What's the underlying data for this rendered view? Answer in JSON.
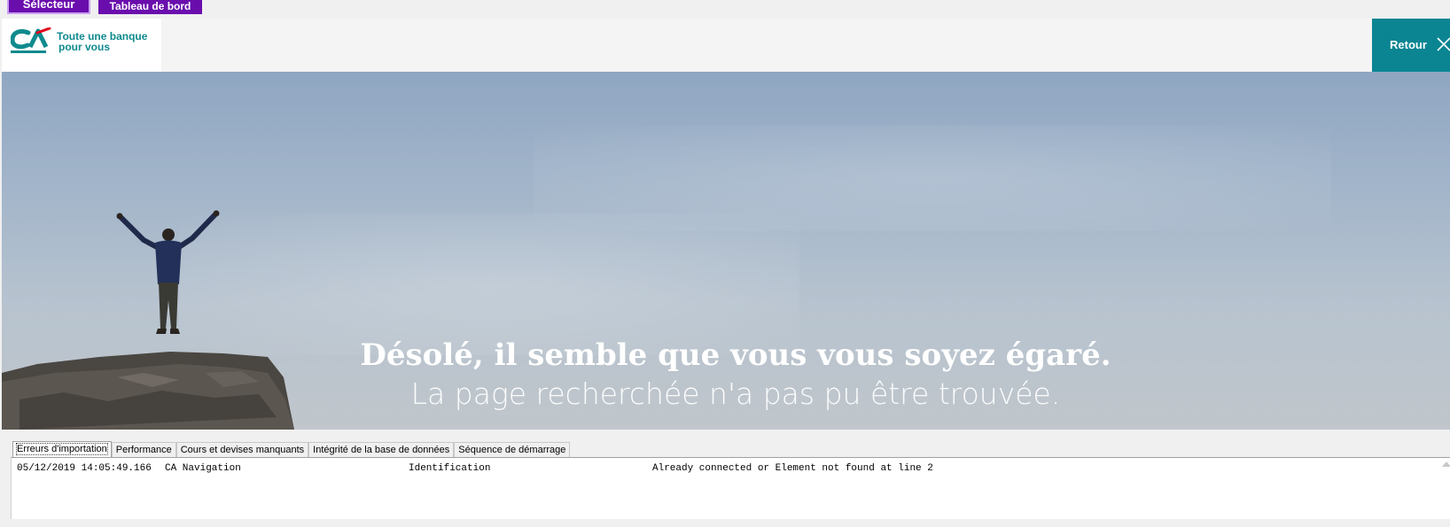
{
  "toolbar": {
    "selector_label": "Sélecteur",
    "dashboard_label": "Tableau de bord"
  },
  "header": {
    "logo_line1": "Toute une banque",
    "logo_line2": "pour vous",
    "retour_label": "Retour"
  },
  "hero": {
    "title": "Désolé, il semble que vous vous soyez égaré.",
    "subtitle": "La page recherchée n'a pas pu être trouvée."
  },
  "tabs": [
    {
      "label": "Erreurs d'importation",
      "active": true
    },
    {
      "label": "Performance",
      "active": false
    },
    {
      "label": "Cours et devises manquants",
      "active": false
    },
    {
      "label": "Intégrité de la base de données",
      "active": false
    },
    {
      "label": "Séquence de démarrage",
      "active": false
    }
  ],
  "log": {
    "rows": [
      {
        "timestamp": "05/12/2019 14:05:49.166",
        "source": "CA Navigation",
        "step": "Identification",
        "message": "Already connected or Element not found at line 2"
      }
    ]
  },
  "colors": {
    "toolbar_button": "#6a0dad",
    "retour_button": "#0b8592",
    "logo_teal": "#0f8a8e",
    "logo_red": "#e2001a"
  }
}
